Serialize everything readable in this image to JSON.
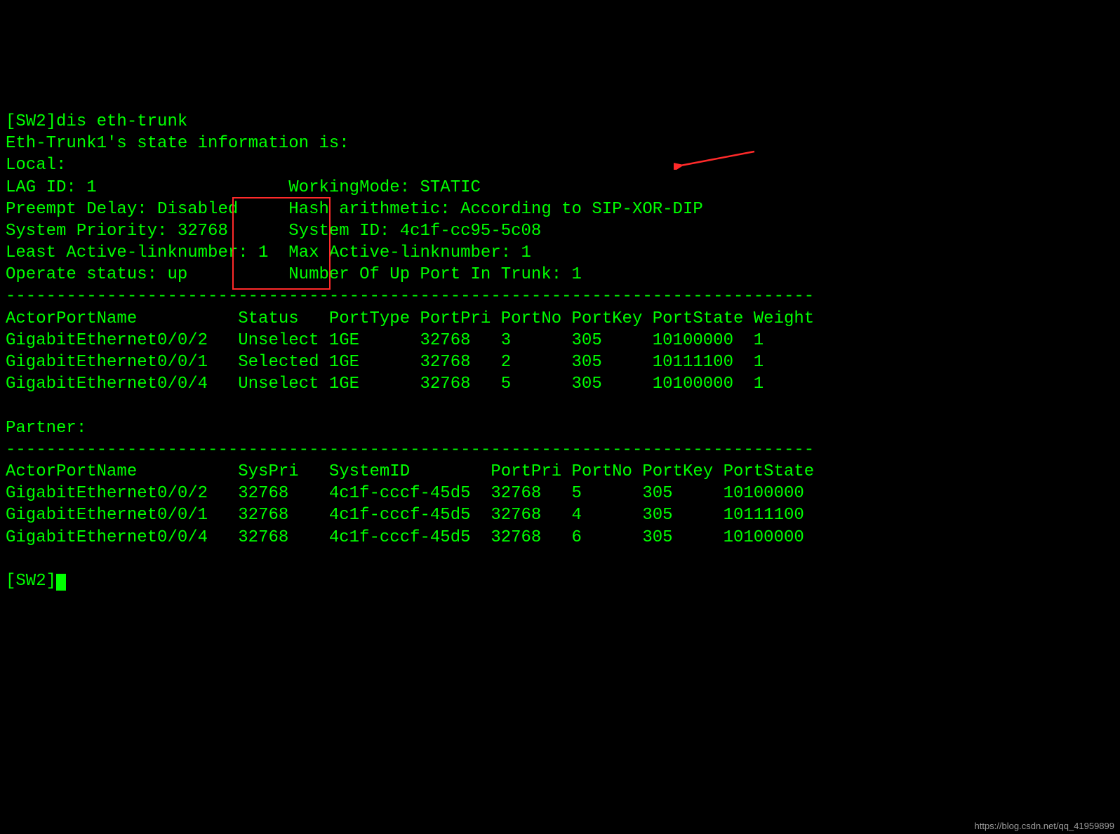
{
  "prompt1": "[SW2]dis eth-trunk",
  "header_line": "Eth-Trunk1's state information is:",
  "local_label": "Local:",
  "row_lag": "LAG ID: 1                   WorkingMode: STATIC",
  "row_preempt": "Preempt Delay: Disabled     Hash arithmetic: According to SIP-XOR-DIP",
  "row_syspri": "System Priority: 32768      System ID: 4c1f-cc95-5c08",
  "row_active": "Least Active-linknumber: 1  Max Active-linknumber: 1",
  "row_operate": "Operate status: up          Number Of Up Port In Trunk: 1",
  "dash_line": "--------------------------------------------------------------------------------",
  "local_table": {
    "header": "ActorPortName          Status   PortType PortPri PortNo PortKey PortState Weight",
    "rows": [
      "GigabitEthernet0/0/2   Unselect 1GE      32768   3      305     10100000  1",
      "GigabitEthernet0/0/1   Selected 1GE      32768   2      305     10111100  1",
      "GigabitEthernet0/0/4   Unselect 1GE      32768   5      305     10100000  1"
    ]
  },
  "partner_label": "Partner:",
  "partner_table": {
    "header": "ActorPortName          SysPri   SystemID        PortPri PortNo PortKey PortState",
    "rows": [
      "GigabitEthernet0/0/2   32768    4c1f-cccf-45d5  32768   5      305     10100000",
      "GigabitEthernet0/0/1   32768    4c1f-cccf-45d5  32768   4      305     10111100",
      "GigabitEthernet0/0/4   32768    4c1f-cccf-45d5  32768   6      305     10100000"
    ]
  },
  "prompt2": "[SW2]",
  "watermark": "https://blog.csdn.net/qq_41959899",
  "annotations": {
    "redbox_label": "Status column highlight",
    "arrow_label": "points to Number Of Up Port In Trunk value"
  },
  "chart_data": {
    "type": "table",
    "title": "Eth-Trunk1 state information (SW2, dis eth-trunk)",
    "meta": {
      "LAG ID": 1,
      "WorkingMode": "STATIC",
      "Preempt Delay": "Disabled",
      "Hash arithmetic": "According to SIP-XOR-DIP",
      "System Priority": 32768,
      "System ID": "4c1f-cc95-5c08",
      "Least Active-linknumber": 1,
      "Max Active-linknumber": 1,
      "Operate status": "up",
      "Number Of Up Port In Trunk": 1
    },
    "local": {
      "columns": [
        "ActorPortName",
        "Status",
        "PortType",
        "PortPri",
        "PortNo",
        "PortKey",
        "PortState",
        "Weight"
      ],
      "rows": [
        [
          "GigabitEthernet0/0/2",
          "Unselect",
          "1GE",
          32768,
          3,
          305,
          "10100000",
          1
        ],
        [
          "GigabitEthernet0/0/1",
          "Selected",
          "1GE",
          32768,
          2,
          305,
          "10111100",
          1
        ],
        [
          "GigabitEthernet0/0/4",
          "Unselect",
          "1GE",
          32768,
          5,
          305,
          "10100000",
          1
        ]
      ]
    },
    "partner": {
      "columns": [
        "ActorPortName",
        "SysPri",
        "SystemID",
        "PortPri",
        "PortNo",
        "PortKey",
        "PortState"
      ],
      "rows": [
        [
          "GigabitEthernet0/0/2",
          32768,
          "4c1f-cccf-45d5",
          32768,
          5,
          305,
          "10100000"
        ],
        [
          "GigabitEthernet0/0/1",
          32768,
          "4c1f-cccf-45d5",
          32768,
          4,
          305,
          "10111100"
        ],
        [
          "GigabitEthernet0/0/4",
          32768,
          "4c1f-cccf-45d5",
          32768,
          6,
          305,
          "10100000"
        ]
      ]
    }
  }
}
